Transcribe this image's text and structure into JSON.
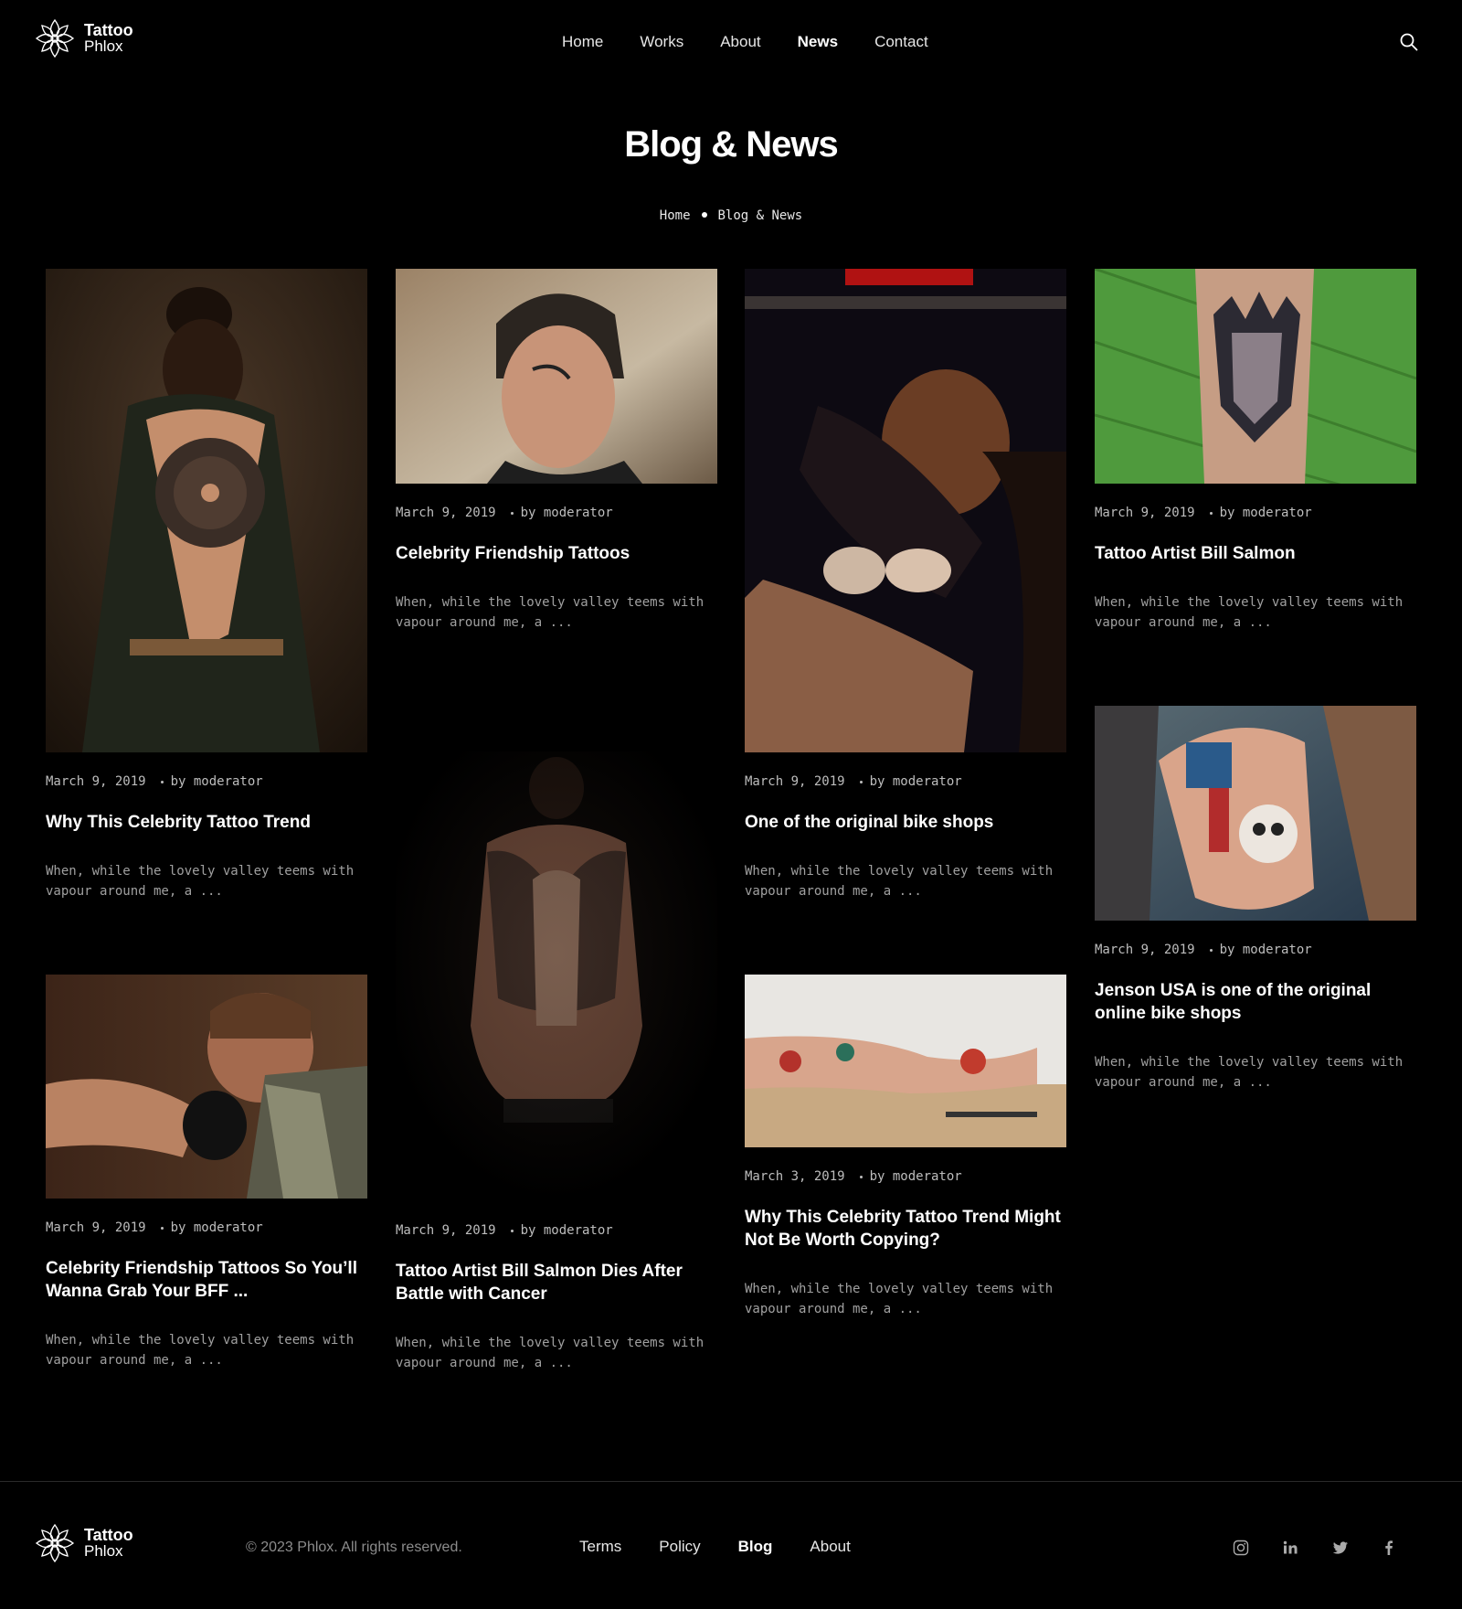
{
  "brand": {
    "line1": "Tattoo",
    "line2": "Phlox"
  },
  "nav": [
    "Home",
    "Works",
    "About",
    "News",
    "Contact"
  ],
  "nav_active": "News",
  "page_title": "Blog & News",
  "breadcrumb": {
    "home": "Home",
    "current": "Blog & News"
  },
  "posts": [
    {
      "date": "March 9, 2019",
      "author": "by moderator",
      "title": "Why This Celebrity Tattoo Trend",
      "excerpt": "When, while the lovely valley teems with vapour around me, a ..."
    },
    {
      "date": "March 9, 2019",
      "author": "by moderator",
      "title": "Celebrity Friendship Tattoos",
      "excerpt": "When, while the lovely valley teems with vapour around me, a ..."
    },
    {
      "date": "March 9, 2019",
      "author": "by moderator",
      "title": "One of the original bike shops",
      "excerpt": "When, while the lovely valley teems with vapour around me, a ..."
    },
    {
      "date": "March 9, 2019",
      "author": "by moderator",
      "title": "Tattoo Artist Bill Salmon",
      "excerpt": "When, while the lovely valley teems with vapour around me, a ..."
    },
    {
      "date": "March 9, 2019",
      "author": "by moderator",
      "title": "Jenson USA is one of the original online bike shops",
      "excerpt": "When, while the lovely valley teems with vapour around me, a ..."
    },
    {
      "date": "March 9, 2019",
      "author": "by moderator",
      "title": "Tattoo Artist Bill Salmon Dies After Battle with Cancer",
      "excerpt": "When, while the lovely valley teems with vapour around me, a ..."
    },
    {
      "date": "March 3, 2019",
      "author": "by moderator",
      "title": "Why This Celebrity Tattoo Trend Might Not Be Worth Copying?",
      "excerpt": "When, while the lovely valley teems with vapour around me, a ..."
    },
    {
      "date": "March 9, 2019",
      "author": "by moderator",
      "title": "Celebrity Friendship Tattoos So You’ll Wanna Grab Your BFF ...",
      "excerpt": "When, while the lovely valley teems with vapour around me, a ..."
    }
  ],
  "footer": {
    "copyright": "© 2023 Phlox. All rights reserved.",
    "links": [
      "Terms",
      "Policy",
      "Blog",
      "About"
    ],
    "active_link": "Blog",
    "social": [
      "instagram-icon",
      "linkedin-icon",
      "twitter-icon",
      "facebook-icon"
    ]
  }
}
